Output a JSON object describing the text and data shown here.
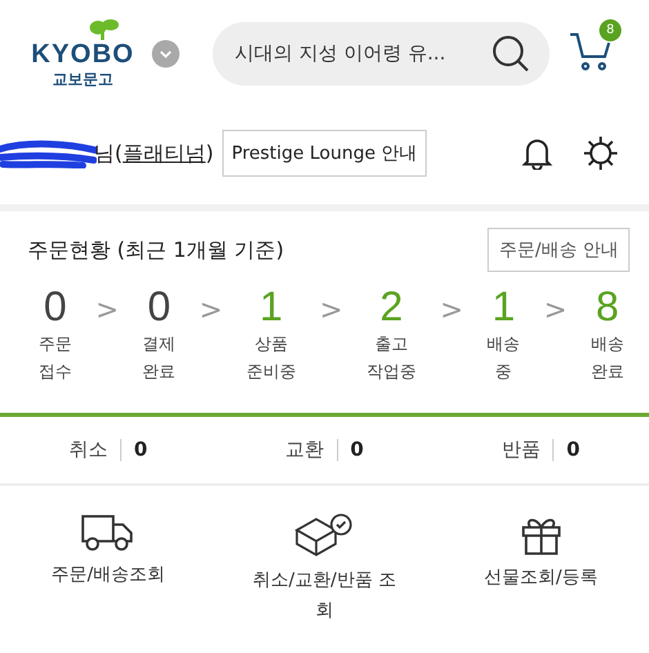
{
  "header": {
    "logo_text": "KYOBO",
    "logo_subtext": "교보문고",
    "search": {
      "placeholder": "시대의 지성 이어령 유..."
    },
    "cart_badge": "8"
  },
  "profile": {
    "name_suffix": "님(",
    "grade": "플래티넘",
    "close": ")",
    "lounge_button": "Prestige Lounge 안내"
  },
  "order_status": {
    "title": "주문현황 (최근 1개월 기준)",
    "guide_button": "주문/배송 안내",
    "separator": ">",
    "steps": [
      {
        "count": "0",
        "label": [
          "주문",
          "접수"
        ],
        "color": "#444444"
      },
      {
        "count": "0",
        "label": [
          "결제",
          "완료"
        ],
        "color": "#444444"
      },
      {
        "count": "1",
        "label": [
          "상품",
          "준비중"
        ],
        "color": "#5aa321"
      },
      {
        "count": "2",
        "label": [
          "출고",
          "작업중"
        ],
        "color": "#5aa321"
      },
      {
        "count": "1",
        "label": [
          "배송",
          "중"
        ],
        "color": "#5aa321"
      },
      {
        "count": "8",
        "label": [
          "배송",
          "완료"
        ],
        "color": "#5aa321"
      }
    ]
  },
  "claims": [
    {
      "label": "취소",
      "count": "0"
    },
    {
      "label": "교환",
      "count": "0"
    },
    {
      "label": "반품",
      "count": "0"
    }
  ],
  "shortcuts": [
    {
      "kind": "truck",
      "label": "주문/배송조회"
    },
    {
      "kind": "box",
      "label": "취소/교환/반품 조회"
    },
    {
      "kind": "gift",
      "label": "선물조회/등록"
    }
  ]
}
